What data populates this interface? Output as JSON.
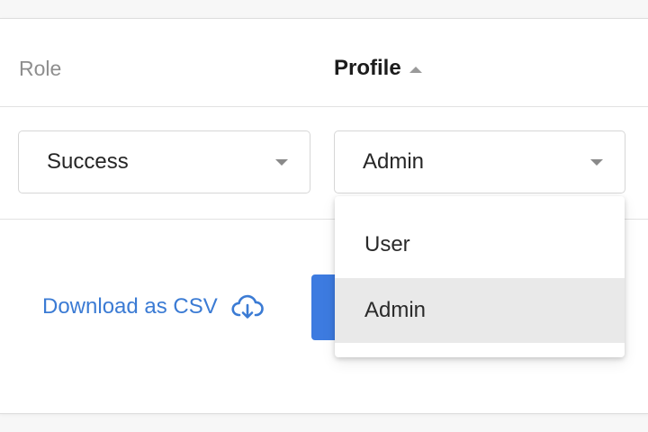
{
  "table": {
    "headers": {
      "role": "Role",
      "profile": "Profile"
    },
    "row": {
      "role_value": "Success",
      "profile_value": "Admin"
    }
  },
  "profile_dropdown": {
    "options": [
      "User",
      "Admin"
    ],
    "highlighted": "Admin"
  },
  "footer": {
    "download_label": "Download as CSV"
  },
  "colors": {
    "accent": "#3b7bd4",
    "button": "#3d7be0",
    "highlight": "#e9e9e9"
  },
  "icons": {
    "sort": "sort-ascending-icon",
    "caret": "chevron-down-icon",
    "download": "cloud-download-icon"
  }
}
